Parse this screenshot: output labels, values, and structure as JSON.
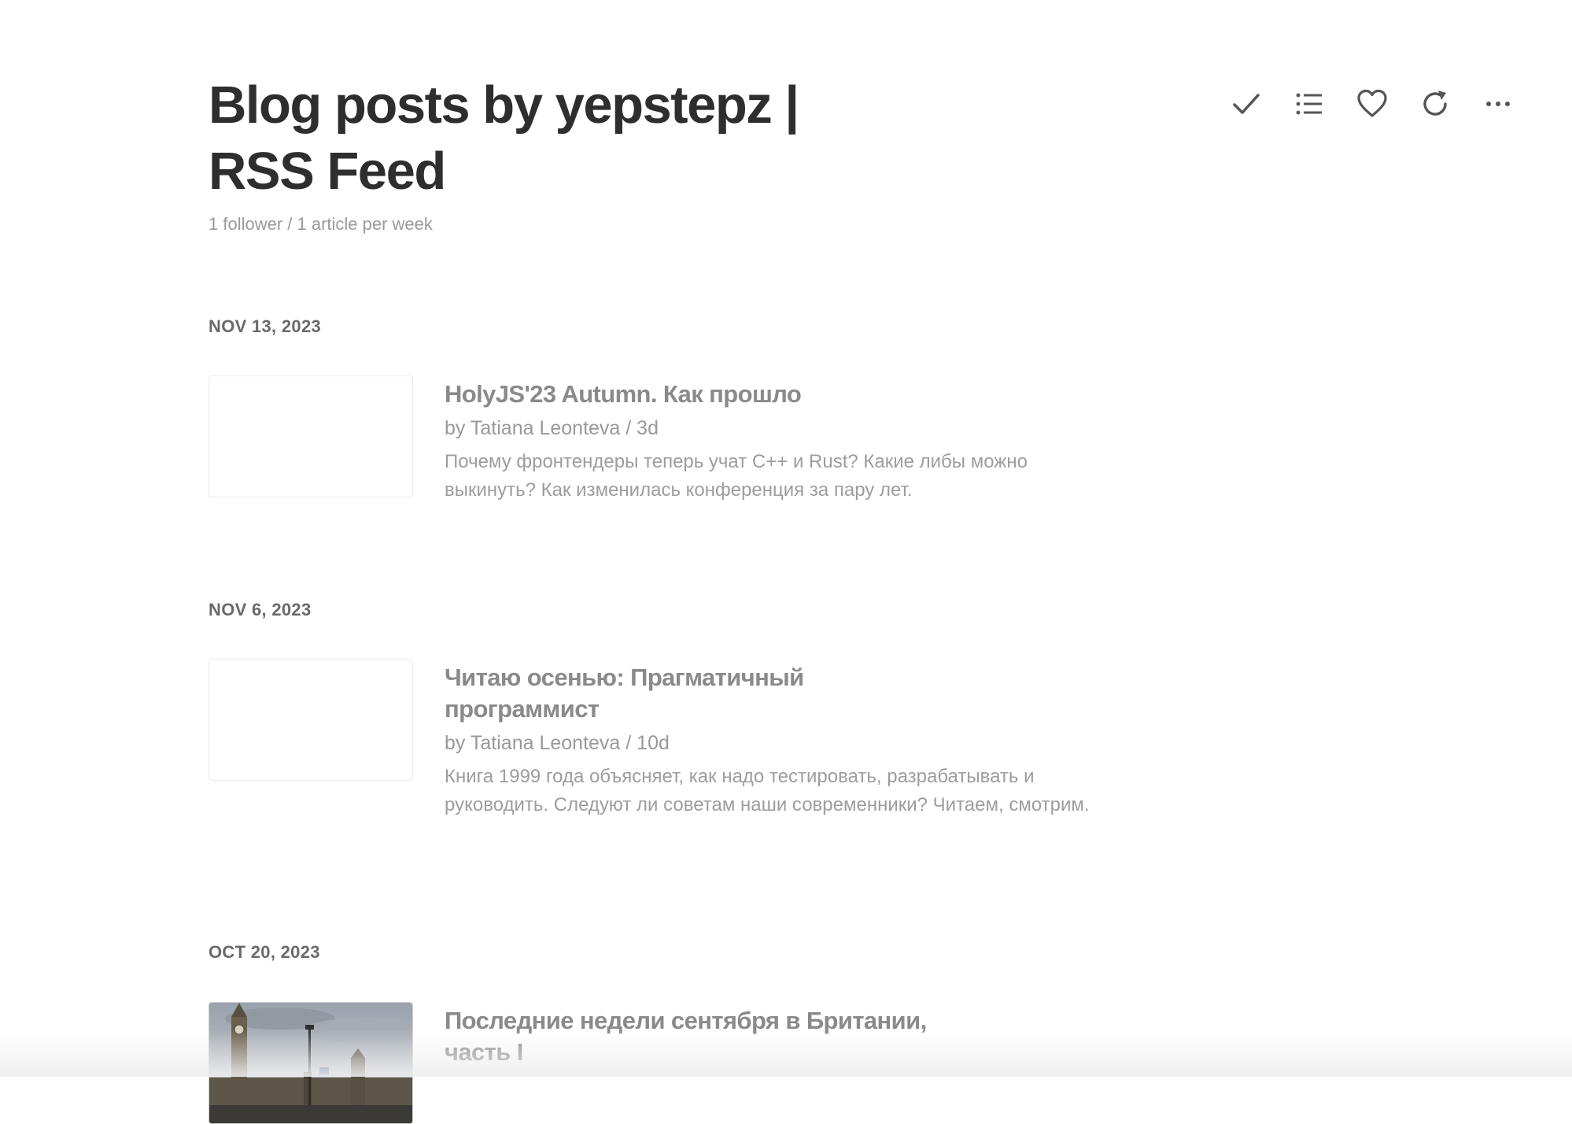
{
  "feed": {
    "title": "Blog posts by yepstepz | RSS Feed",
    "meta": "1 follower / 1 article per week"
  },
  "toolbar": {
    "items": [
      {
        "icon": "checkmark-icon"
      },
      {
        "icon": "list-icon"
      },
      {
        "icon": "heart-icon"
      },
      {
        "icon": "refresh-icon"
      },
      {
        "icon": "more-icon"
      }
    ]
  },
  "sections": [
    {
      "date": "NOV 13, 2023",
      "article": {
        "title": "HolyJS'23 Autumn. Как прошло",
        "byline": "by Tatiana Leonteva / 3d",
        "summary": "Почему фронтендеры теперь учат C++ и Rust? Какие либы можно выкинуть? Как изменилась конференция за пару лет."
      }
    },
    {
      "date": "NOV 6, 2023",
      "article": {
        "title": "Читаю осенью: Прагматичный программист",
        "byline": "by Tatiana Leonteva / 10d",
        "summary": "Книга 1999 года объясняет, как надо тестировать, разрабатывать и руководить. Следуют ли советам наши современники? Читаем, смотрим."
      }
    },
    {
      "date": "OCT 20, 2023",
      "article": {
        "title": "Последние недели сентября в Британии, часть I"
      }
    }
  ],
  "colors": {
    "title": "#2e2e2e",
    "muted": "#999999",
    "icon": "#555555"
  }
}
